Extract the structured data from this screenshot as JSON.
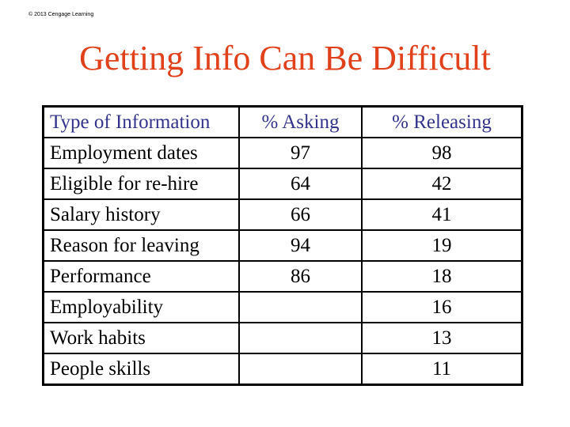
{
  "copyright": "© 2013 Cengage Learning",
  "title": "Getting Info Can Be Difficult",
  "colors": {
    "title": "#e0401a",
    "header_text": "#33338c",
    "body_text": "#000000"
  },
  "table": {
    "headers": [
      "Type of Information",
      "% Asking",
      "% Releasing"
    ],
    "rows": [
      [
        "Employment dates",
        "97",
        "98"
      ],
      [
        "Eligible for re-hire",
        "64",
        "42"
      ],
      [
        "Salary history",
        "66",
        "41"
      ],
      [
        "Reason for leaving",
        "94",
        "19"
      ],
      [
        "Performance",
        "86",
        "18"
      ],
      [
        "Employability",
        "",
        "16"
      ],
      [
        "Work habits",
        "",
        "13"
      ],
      [
        "People skills",
        "",
        "11"
      ]
    ]
  }
}
